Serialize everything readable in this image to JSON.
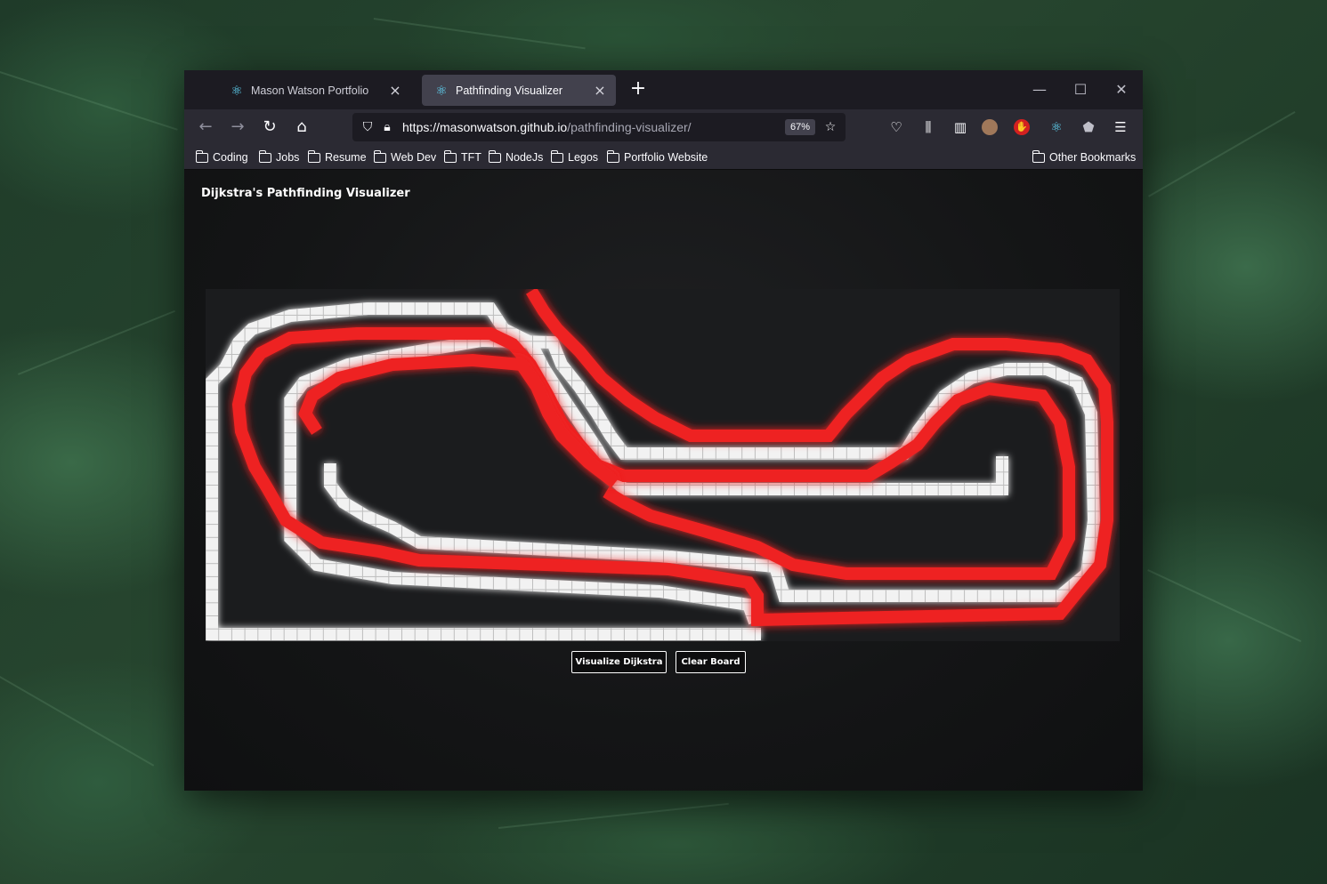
{
  "browser": {
    "tabs": [
      {
        "label": "Mason Watson Portfolio",
        "icon": "react-icon",
        "active": false
      },
      {
        "label": "Pathfinding Visualizer",
        "icon": "react-icon",
        "active": true
      }
    ],
    "url_host": "https://masonwatson.github.io",
    "url_path": "/pathfinding-visualizer/",
    "zoom": "67%",
    "bookmarks": [
      "Coding",
      "Jobs",
      "Resume",
      "Web Dev",
      "TFT",
      "NodeJs",
      "Legos",
      "Portfolio Website"
    ],
    "other_bookmarks": "Other Bookmarks"
  },
  "app": {
    "title": "Dijkstra's Pathfinding Visualizer",
    "buttons": {
      "visualize": "Visualize Dijkstra",
      "clear": "Clear Board"
    },
    "colors": {
      "wall": "#f2f2f2",
      "path": "#ee2222",
      "board": "#1b1c1e"
    }
  }
}
